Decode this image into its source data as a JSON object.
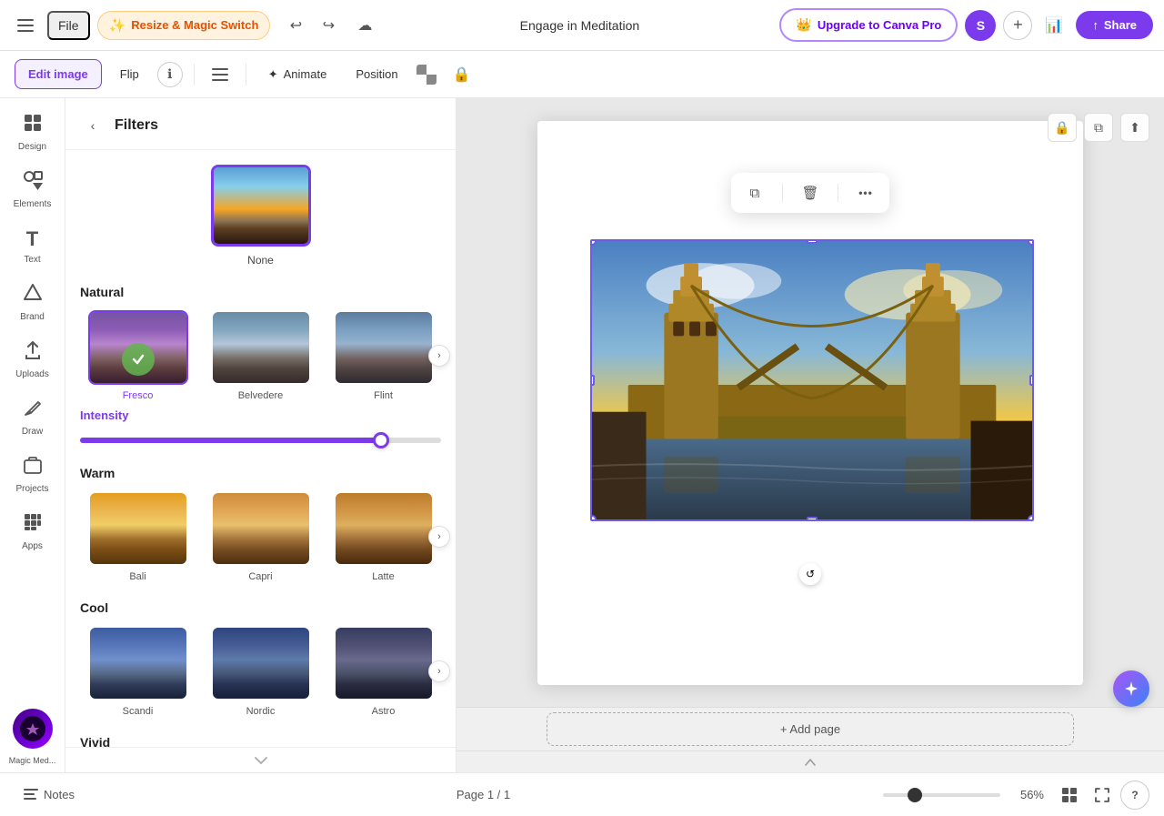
{
  "topbar": {
    "hamburger_label": "☰",
    "file_label": "File",
    "magic_switch_label": "Resize & Magic Switch",
    "magic_emoji": "✨",
    "undo_icon": "↩",
    "redo_icon": "↪",
    "cloud_icon": "☁",
    "title": "Engage in Meditation",
    "upgrade_label": "Upgrade to Canva Pro",
    "upgrade_crown": "👑",
    "avatar_letter": "S",
    "plus_label": "+",
    "chart_icon": "📊",
    "share_label": "Share",
    "share_icon": "↑"
  },
  "secondary_toolbar": {
    "edit_image_label": "Edit image",
    "flip_label": "Flip",
    "info_icon": "ℹ",
    "menu_icon": "≡",
    "animate_icon": "✦",
    "animate_label": "Animate",
    "position_label": "Position",
    "lock_icon": "🔒",
    "copy_icon": "⧉",
    "external_icon": "⬆"
  },
  "filter_panel": {
    "title": "Filters",
    "back_icon": "‹",
    "none_label": "None",
    "natural_label": "Natural",
    "warm_label": "Warm",
    "cool_label": "Cool",
    "vivid_label": "Vivid",
    "intensity_label": "Intensity",
    "intensity_value": 85,
    "natural_filters": [
      {
        "label": "Fresco",
        "selected": true,
        "style": "bridge-natural1"
      },
      {
        "label": "Belvedere",
        "selected": false,
        "style": "bridge-natural2"
      },
      {
        "label": "Flint",
        "selected": false,
        "style": "bridge-natural3"
      }
    ],
    "warm_filters": [
      {
        "label": "Bali",
        "selected": false,
        "style": "bridge-warm1"
      },
      {
        "label": "Capri",
        "selected": false,
        "style": "bridge-warm2"
      },
      {
        "label": "Latte",
        "selected": false,
        "style": "bridge-warm3"
      }
    ],
    "cool_filters": [
      {
        "label": "Scandi",
        "selected": false,
        "style": "bridge-cool1"
      },
      {
        "label": "Nordic",
        "selected": false,
        "style": "bridge-cool2"
      },
      {
        "label": "Astro",
        "selected": false,
        "style": "bridge-cool3"
      }
    ]
  },
  "sidebar": {
    "items": [
      {
        "label": "Design",
        "icon": "⊞",
        "active": false
      },
      {
        "label": "Elements",
        "icon": "✦",
        "active": false
      },
      {
        "label": "Text",
        "icon": "T",
        "active": false
      },
      {
        "label": "Brand",
        "icon": "◈",
        "active": false
      },
      {
        "label": "Uploads",
        "icon": "⬆",
        "active": false
      },
      {
        "label": "Draw",
        "icon": "✏",
        "active": false
      },
      {
        "label": "Projects",
        "icon": "▤",
        "active": false
      },
      {
        "label": "Apps",
        "icon": "⚙",
        "active": false
      }
    ],
    "magic_med_label": "Magic Med..."
  },
  "canvas": {
    "context_menu": {
      "copy_icon": "⧉",
      "delete_icon": "🗑",
      "more_icon": "•••"
    },
    "add_page_label": "+ Add page",
    "rotate_icon": "↻",
    "rotate_bottom_icon": "↺"
  },
  "bottom_bar": {
    "notes_icon": "≡",
    "notes_label": "Notes",
    "page_info": "Page 1 / 1",
    "zoom_value": "56%",
    "zoom_percent": 56,
    "layout_icon": "⊞",
    "fullscreen_icon": "⛶",
    "help_icon": "?"
  }
}
